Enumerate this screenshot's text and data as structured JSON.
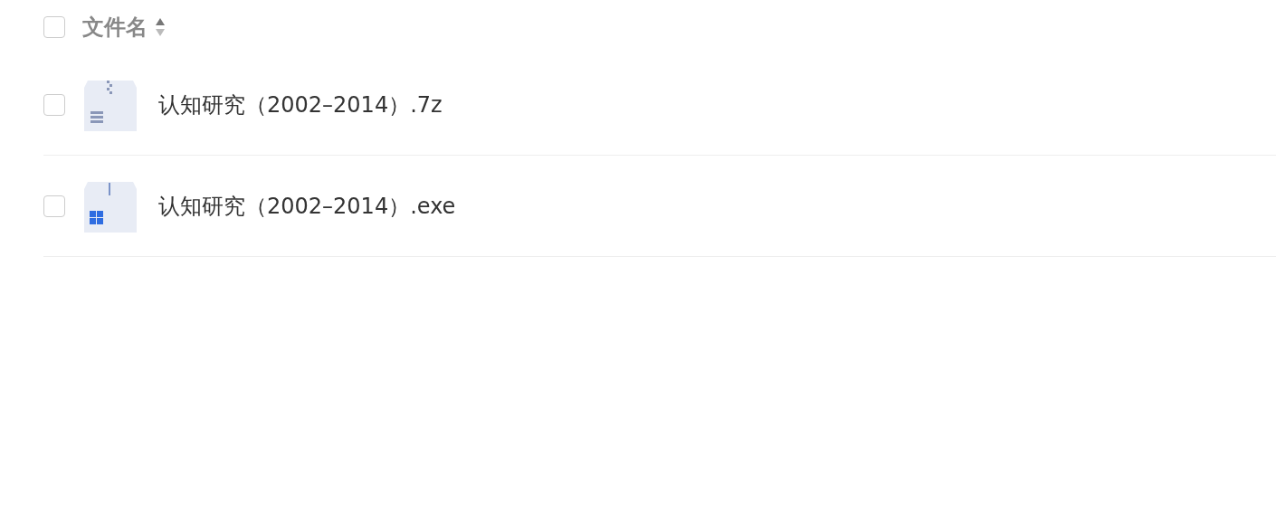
{
  "header": {
    "checked": false,
    "label": "文件名"
  },
  "files": [
    {
      "name": "认知研究（2002–2014）.7z",
      "kind": "archive",
      "checked": false
    },
    {
      "name": "认知研究（2002–2014）.exe",
      "kind": "executable",
      "checked": false
    }
  ]
}
